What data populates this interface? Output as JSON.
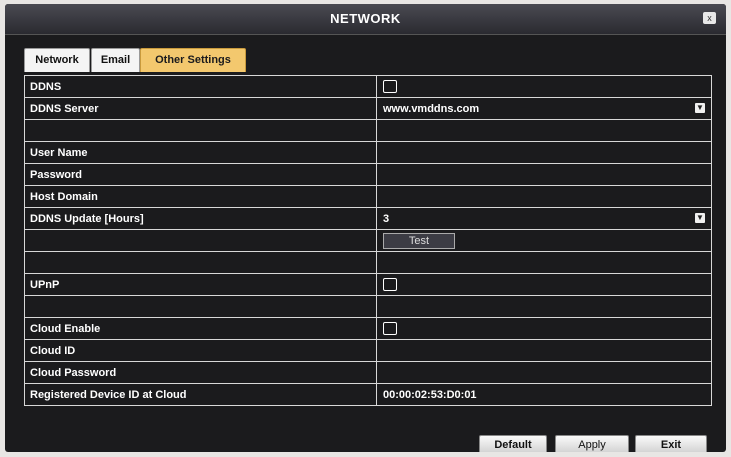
{
  "window": {
    "title": "NETWORK",
    "close_glyph": "x"
  },
  "tabs": [
    {
      "label": "Network",
      "active": false
    },
    {
      "label": "Email",
      "active": false
    },
    {
      "label": "Other Settings",
      "active": true
    }
  ],
  "rows": [
    {
      "label": "DDNS",
      "type": "checkbox"
    },
    {
      "label": "DDNS Server",
      "type": "dropdown",
      "value": "www.vmddns.com"
    },
    {
      "label": "",
      "type": "empty"
    },
    {
      "label": "User Name",
      "type": "text",
      "value": ""
    },
    {
      "label": "Password",
      "type": "text",
      "value": ""
    },
    {
      "label": "Host Domain",
      "type": "text",
      "value": ""
    },
    {
      "label": "DDNS Update [Hours]",
      "type": "dropdown",
      "value": "3"
    },
    {
      "label": "",
      "type": "button",
      "value": "Test"
    },
    {
      "label": "",
      "type": "empty"
    },
    {
      "label": "UPnP",
      "type": "checkbox"
    },
    {
      "label": "",
      "type": "empty"
    },
    {
      "label": "Cloud Enable",
      "type": "checkbox"
    },
    {
      "label": "Cloud ID",
      "type": "text",
      "value": ""
    },
    {
      "label": "Cloud Password",
      "type": "text",
      "value": ""
    },
    {
      "label": "Registered Device ID at Cloud",
      "type": "text",
      "value": "00:00:02:53:D0:01"
    }
  ],
  "buttons": {
    "default": "Default",
    "apply": "Apply",
    "exit": "Exit"
  },
  "colors": {
    "background": "#1b1b1d",
    "active_tab": "#f3c86e",
    "grid_line": "#d8d8d8",
    "text": "#ffffff"
  }
}
